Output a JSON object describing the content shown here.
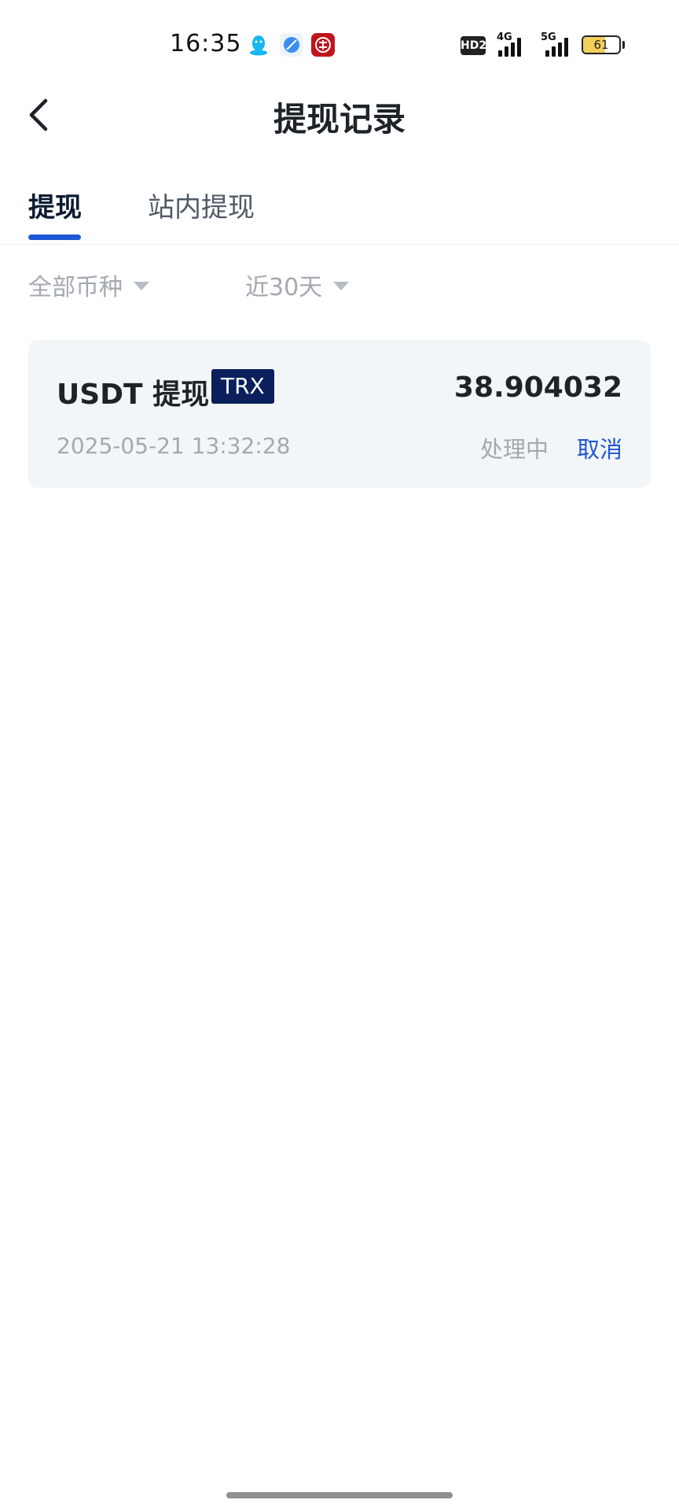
{
  "status_bar": {
    "time": "16:35",
    "battery_level": "61",
    "battery_fraction": 0.61,
    "network_1": "4G",
    "network_2": "5G",
    "hd_badge": "HD2",
    "app_icons": [
      "qq-icon",
      "feather-icon",
      "bank-icon"
    ]
  },
  "header": {
    "title": "提现记录",
    "back_icon": "chevron-left-icon"
  },
  "tabs": [
    {
      "label": "提现",
      "active": true
    },
    {
      "label": "站内提现",
      "active": false
    }
  ],
  "filters": [
    {
      "label": "全部币种",
      "icon": "caret-down-icon"
    },
    {
      "label": "近30天",
      "icon": "caret-down-icon"
    }
  ],
  "records": [
    {
      "title": "USDT 提现",
      "network": "TRX",
      "amount": "38.904032",
      "time": "2025-05-21 13:32:28",
      "status": "处理中",
      "action": "取消"
    }
  ],
  "colors": {
    "accent": "#1f56d6",
    "badge_bg": "#0a1f5c",
    "card_bg": "#f3f6f8",
    "muted_text": "#a4a9b0"
  }
}
